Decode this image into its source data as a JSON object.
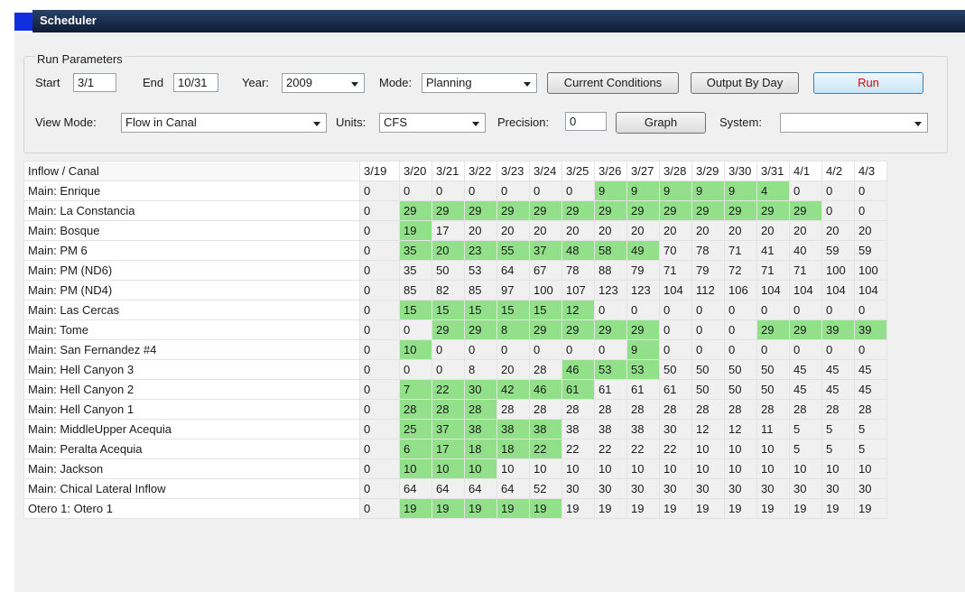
{
  "window": {
    "title": "Scheduler"
  },
  "run_parameters": {
    "group_label": "Run Parameters",
    "start_label": "Start",
    "start_value": "3/1",
    "end_label": "End",
    "end_value": "10/31",
    "year_label": "Year:",
    "year_value": "2009",
    "mode_label": "Mode:",
    "mode_value": "Planning",
    "current_conditions_label": "Current Conditions",
    "output_by_day_label": "Output By Day",
    "run_label": "Run",
    "view_mode_label": "View Mode:",
    "view_mode_value": "Flow in Canal",
    "units_label": "Units:",
    "units_value": "CFS",
    "precision_label": "Precision:",
    "precision_value": "0",
    "graph_label": "Graph",
    "system_label": "System:",
    "system_value": ""
  },
  "table": {
    "name_header": "Inflow / Canal",
    "columns": [
      "3/19",
      "3/20",
      "3/21",
      "3/22",
      "3/23",
      "3/24",
      "3/25",
      "3/26",
      "3/27",
      "3/28",
      "3/29",
      "3/30",
      "3/31",
      "4/1",
      "4/2",
      "4/3"
    ],
    "highlight_color": "#92e08a",
    "rows": [
      {
        "name": "Main: Enrique",
        "values": [
          "0",
          "0",
          "0",
          "0",
          "0",
          "0",
          "0",
          "9",
          "9",
          "9",
          "9",
          "9",
          "4",
          "0",
          "0",
          "0"
        ],
        "highlighted": [
          7,
          8,
          9,
          10,
          11,
          12
        ]
      },
      {
        "name": "Main: La Constancia",
        "values": [
          "0",
          "29",
          "29",
          "29",
          "29",
          "29",
          "29",
          "29",
          "29",
          "29",
          "29",
          "29",
          "29",
          "29",
          "0",
          "0"
        ],
        "highlighted": [
          1,
          2,
          3,
          4,
          5,
          6,
          7,
          8,
          9,
          10,
          11,
          12,
          13
        ]
      },
      {
        "name": "Main: Bosque",
        "values": [
          "0",
          "19",
          "17",
          "20",
          "20",
          "20",
          "20",
          "20",
          "20",
          "20",
          "20",
          "20",
          "20",
          "20",
          "20",
          "20"
        ],
        "highlighted": [
          1
        ]
      },
      {
        "name": "Main: PM 6",
        "values": [
          "0",
          "35",
          "20",
          "23",
          "55",
          "37",
          "48",
          "58",
          "49",
          "70",
          "78",
          "71",
          "41",
          "40",
          "59",
          "59"
        ],
        "highlighted": [
          1,
          2,
          3,
          4,
          5,
          6,
          7,
          8
        ]
      },
      {
        "name": "Main: PM (ND6)",
        "values": [
          "0",
          "35",
          "50",
          "53",
          "64",
          "67",
          "78",
          "88",
          "79",
          "71",
          "79",
          "72",
          "71",
          "71",
          "100",
          "100"
        ],
        "highlighted": []
      },
      {
        "name": "Main: PM (ND4)",
        "values": [
          "0",
          "85",
          "82",
          "85",
          "97",
          "100",
          "107",
          "123",
          "123",
          "104",
          "112",
          "106",
          "104",
          "104",
          "104",
          "104"
        ],
        "highlighted": []
      },
      {
        "name": "Main: Las Cercas",
        "values": [
          "0",
          "15",
          "15",
          "15",
          "15",
          "15",
          "12",
          "0",
          "0",
          "0",
          "0",
          "0",
          "0",
          "0",
          "0",
          "0"
        ],
        "highlighted": [
          1,
          2,
          3,
          4,
          5,
          6
        ]
      },
      {
        "name": "Main: Tome",
        "values": [
          "0",
          "0",
          "29",
          "29",
          "8",
          "29",
          "29",
          "29",
          "29",
          "0",
          "0",
          "0",
          "29",
          "29",
          "39",
          "39"
        ],
        "highlighted": [
          2,
          3,
          4,
          5,
          6,
          7,
          8,
          12,
          13,
          14,
          15
        ]
      },
      {
        "name": "Main: San Fernandez #4",
        "values": [
          "0",
          "10",
          "0",
          "0",
          "0",
          "0",
          "0",
          "0",
          "9",
          "0",
          "0",
          "0",
          "0",
          "0",
          "0",
          "0"
        ],
        "highlighted": [
          1,
          8
        ]
      },
      {
        "name": "Main: Hell Canyon 3",
        "values": [
          "0",
          "0",
          "0",
          "8",
          "20",
          "28",
          "46",
          "53",
          "53",
          "50",
          "50",
          "50",
          "50",
          "45",
          "45",
          "45"
        ],
        "highlighted": [
          6,
          7,
          8
        ]
      },
      {
        "name": "Main: Hell Canyon 2",
        "values": [
          "0",
          "7",
          "22",
          "30",
          "42",
          "46",
          "61",
          "61",
          "61",
          "61",
          "50",
          "50",
          "50",
          "45",
          "45",
          "45"
        ],
        "highlighted": [
          1,
          2,
          3,
          4,
          5,
          6
        ]
      },
      {
        "name": "Main: Hell Canyon 1",
        "values": [
          "0",
          "28",
          "28",
          "28",
          "28",
          "28",
          "28",
          "28",
          "28",
          "28",
          "28",
          "28",
          "28",
          "28",
          "28",
          "28"
        ],
        "highlighted": [
          1,
          2,
          3
        ]
      },
      {
        "name": "Main: MiddleUpper Acequia",
        "values": [
          "0",
          "25",
          "37",
          "38",
          "38",
          "38",
          "38",
          "38",
          "38",
          "30",
          "12",
          "12",
          "11",
          "5",
          "5",
          "5"
        ],
        "highlighted": [
          1,
          2,
          3,
          4,
          5
        ]
      },
      {
        "name": "Main: Peralta Acequia",
        "values": [
          "0",
          "6",
          "17",
          "18",
          "18",
          "22",
          "22",
          "22",
          "22",
          "22",
          "10",
          "10",
          "10",
          "5",
          "5",
          "5"
        ],
        "highlighted": [
          1,
          2,
          3,
          4,
          5
        ]
      },
      {
        "name": "Main: Jackson",
        "values": [
          "0",
          "10",
          "10",
          "10",
          "10",
          "10",
          "10",
          "10",
          "10",
          "10",
          "10",
          "10",
          "10",
          "10",
          "10",
          "10"
        ],
        "highlighted": [
          1,
          2,
          3
        ]
      },
      {
        "name": "Main: Chical Lateral Inflow",
        "values": [
          "0",
          "64",
          "64",
          "64",
          "64",
          "52",
          "30",
          "30",
          "30",
          "30",
          "30",
          "30",
          "30",
          "30",
          "30",
          "30"
        ],
        "highlighted": []
      },
      {
        "name": "Otero 1: Otero 1",
        "values": [
          "0",
          "19",
          "19",
          "19",
          "19",
          "19",
          "19",
          "19",
          "19",
          "19",
          "19",
          "19",
          "19",
          "19",
          "19",
          "19"
        ],
        "highlighted": [
          1,
          2,
          3,
          4,
          5
        ]
      }
    ]
  }
}
